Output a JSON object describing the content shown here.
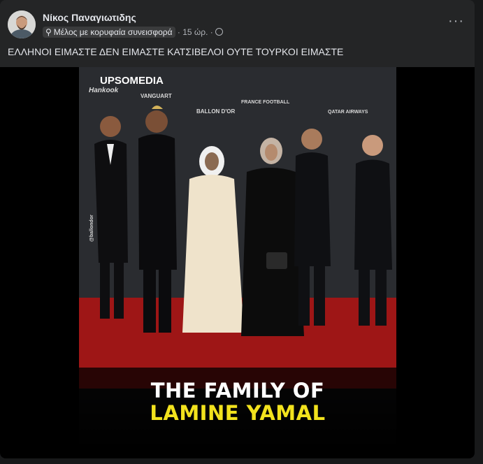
{
  "post": {
    "author": "Νίκος Παναγιωτιδης",
    "badge": "Μέλος με κορυφαία συνεισφορά",
    "time": "· 15 ώρ. ·",
    "text": "ΕΛΛΗΝΟΙ ΕΙΜΑΣΤΕ ΔΕΝ ΕΙΜΑΣΤΕ ΚΑΤΣΙΒΕΛΟΙ ΟΥΤΕ ΤΟΥΡΚΟΙ ΕΙΜΑΣΤΕ",
    "more": "···"
  },
  "image": {
    "line1": "THE FAMILY OF",
    "line2": "LAMINE YAMAL",
    "backdrop": [
      "UPSOMEDIA",
      "Hankook",
      "VANGUART",
      "BALLON D'OR",
      "FRANCE FOOTBALL",
      "QATAR AIRWAYS",
      "@ballondor"
    ]
  },
  "colors": {
    "accent_yellow": "#f2e21d",
    "carpet_red": "#9e1616"
  }
}
